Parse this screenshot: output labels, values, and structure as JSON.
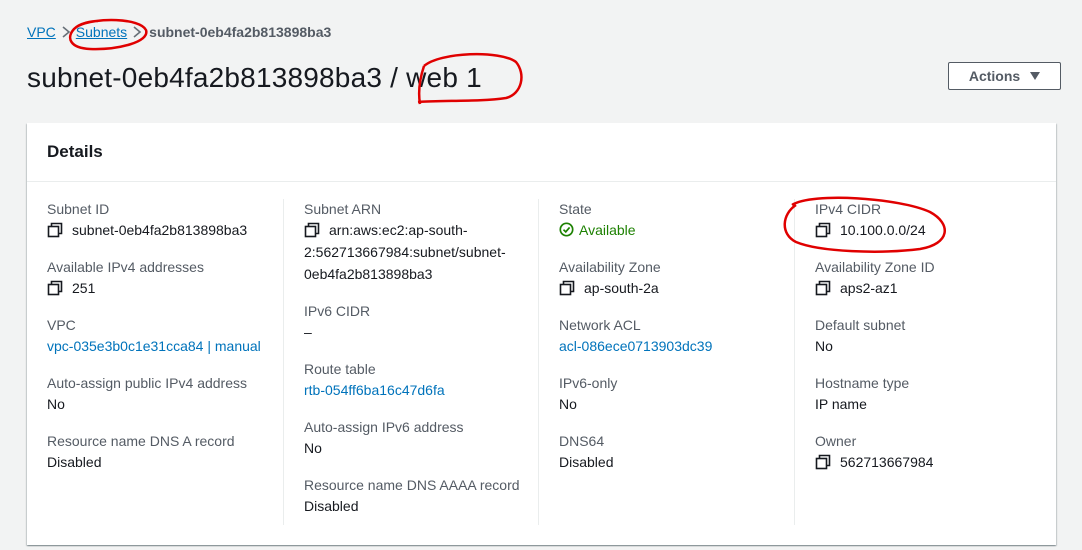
{
  "breadcrumb": {
    "items": [
      "VPC",
      "Subnets"
    ],
    "current": "subnet-0eb4fa2b813898ba3"
  },
  "header": {
    "title": "subnet-0eb4fa2b813898ba3",
    "separator": "/",
    "name": "web 1",
    "actions_label": "Actions"
  },
  "details": {
    "title": "Details",
    "col1": {
      "subnet_id": {
        "label": "Subnet ID",
        "value": "subnet-0eb4fa2b813898ba3"
      },
      "available_ipv4": {
        "label": "Available IPv4 addresses",
        "value": "251"
      },
      "vpc": {
        "label": "VPC",
        "value": "vpc-035e3b0c1e31cca84 | manual"
      },
      "auto_assign_ipv4": {
        "label": "Auto-assign public IPv4 address",
        "value": "No"
      },
      "dns_a": {
        "label": "Resource name DNS A record",
        "value": "Disabled"
      }
    },
    "col2": {
      "subnet_arn": {
        "label": "Subnet ARN",
        "line1": "arn:aws:ec2:ap-south-",
        "line2": "2:562713667984:subnet/subnet-",
        "line3": "0eb4fa2b813898ba3"
      },
      "ipv6_cidr": {
        "label": "IPv6 CIDR",
        "value": "–"
      },
      "route_table": {
        "label": "Route table",
        "value": "rtb-054ff6ba16c47d6fa"
      },
      "auto_assign_ipv6": {
        "label": "Auto-assign IPv6 address",
        "value": "No"
      },
      "dns_aaaa": {
        "label": "Resource name DNS AAAA record",
        "value": "Disabled"
      }
    },
    "col3": {
      "state": {
        "label": "State",
        "value": "Available"
      },
      "az": {
        "label": "Availability Zone",
        "value": "ap-south-2a"
      },
      "network_acl": {
        "label": "Network ACL",
        "value": "acl-086ece0713903dc39"
      },
      "ipv6_only": {
        "label": "IPv6-only",
        "value": "No"
      },
      "dns64": {
        "label": "DNS64",
        "value": "Disabled"
      }
    },
    "col4": {
      "ipv4_cidr": {
        "label": "IPv4 CIDR",
        "value": "10.100.0.0/24"
      },
      "az_id": {
        "label": "Availability Zone ID",
        "value": "aps2-az1"
      },
      "default_subnet": {
        "label": "Default subnet",
        "value": "No"
      },
      "hostname_type": {
        "label": "Hostname type",
        "value": "IP name"
      },
      "owner": {
        "label": "Owner",
        "value": "562713667984"
      }
    }
  },
  "icons": {
    "copy": "copy-icon",
    "status": "check-circle-icon",
    "caret": "caret-down-icon",
    "breadcrumb_sep": "chevron-right-icon"
  },
  "colors": {
    "link": "#0073bb",
    "success": "#1d8102",
    "annotation": "#e00000",
    "background": "#f2f3f3"
  }
}
